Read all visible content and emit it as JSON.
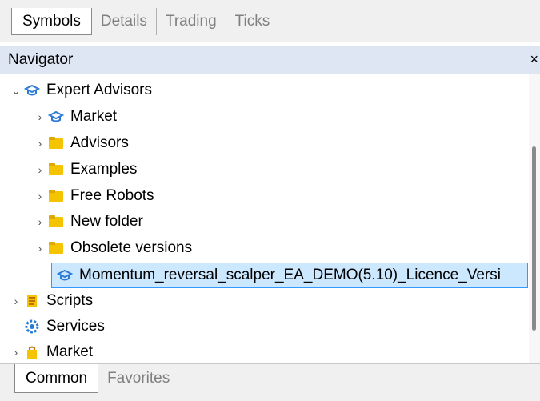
{
  "top_tabs": [
    {
      "label": "Symbols",
      "active": true
    },
    {
      "label": "Details",
      "active": false
    },
    {
      "label": "Trading",
      "active": false
    },
    {
      "label": "Ticks",
      "active": false
    }
  ],
  "navigator": {
    "title": "Navigator",
    "close_glyph": "×"
  },
  "tree": {
    "expert_advisors": {
      "label": "Expert Advisors",
      "icon": "graduation-cap-icon",
      "expanded": true
    },
    "children": [
      {
        "label": "Market",
        "icon": "graduation-cap-icon"
      },
      {
        "label": "Advisors",
        "icon": "folder-icon"
      },
      {
        "label": "Examples",
        "icon": "folder-icon"
      },
      {
        "label": "Free Robots",
        "icon": "folder-icon"
      },
      {
        "label": "New folder",
        "icon": "folder-icon"
      },
      {
        "label": "Obsolete versions",
        "icon": "folder-icon"
      },
      {
        "label": "Momentum_reversal_scalper_EA_DEMO(5.10)_Licence_Versi",
        "icon": "graduation-cap-icon",
        "selected": true
      }
    ],
    "roots": [
      {
        "label": "Scripts",
        "icon": "script-icon"
      },
      {
        "label": "Services",
        "icon": "services-icon"
      },
      {
        "label": "Market",
        "icon": "shopping-bag-icon"
      }
    ]
  },
  "bottom_tabs": [
    {
      "label": "Common",
      "active": true
    },
    {
      "label": "Favorites",
      "active": false
    }
  ],
  "colors": {
    "header_bg": "#dde6f2",
    "selection_bg": "#cce8ff",
    "selection_border": "#3399ff",
    "folder": "#f5c400",
    "cap_icon": "#2b7bd6"
  }
}
